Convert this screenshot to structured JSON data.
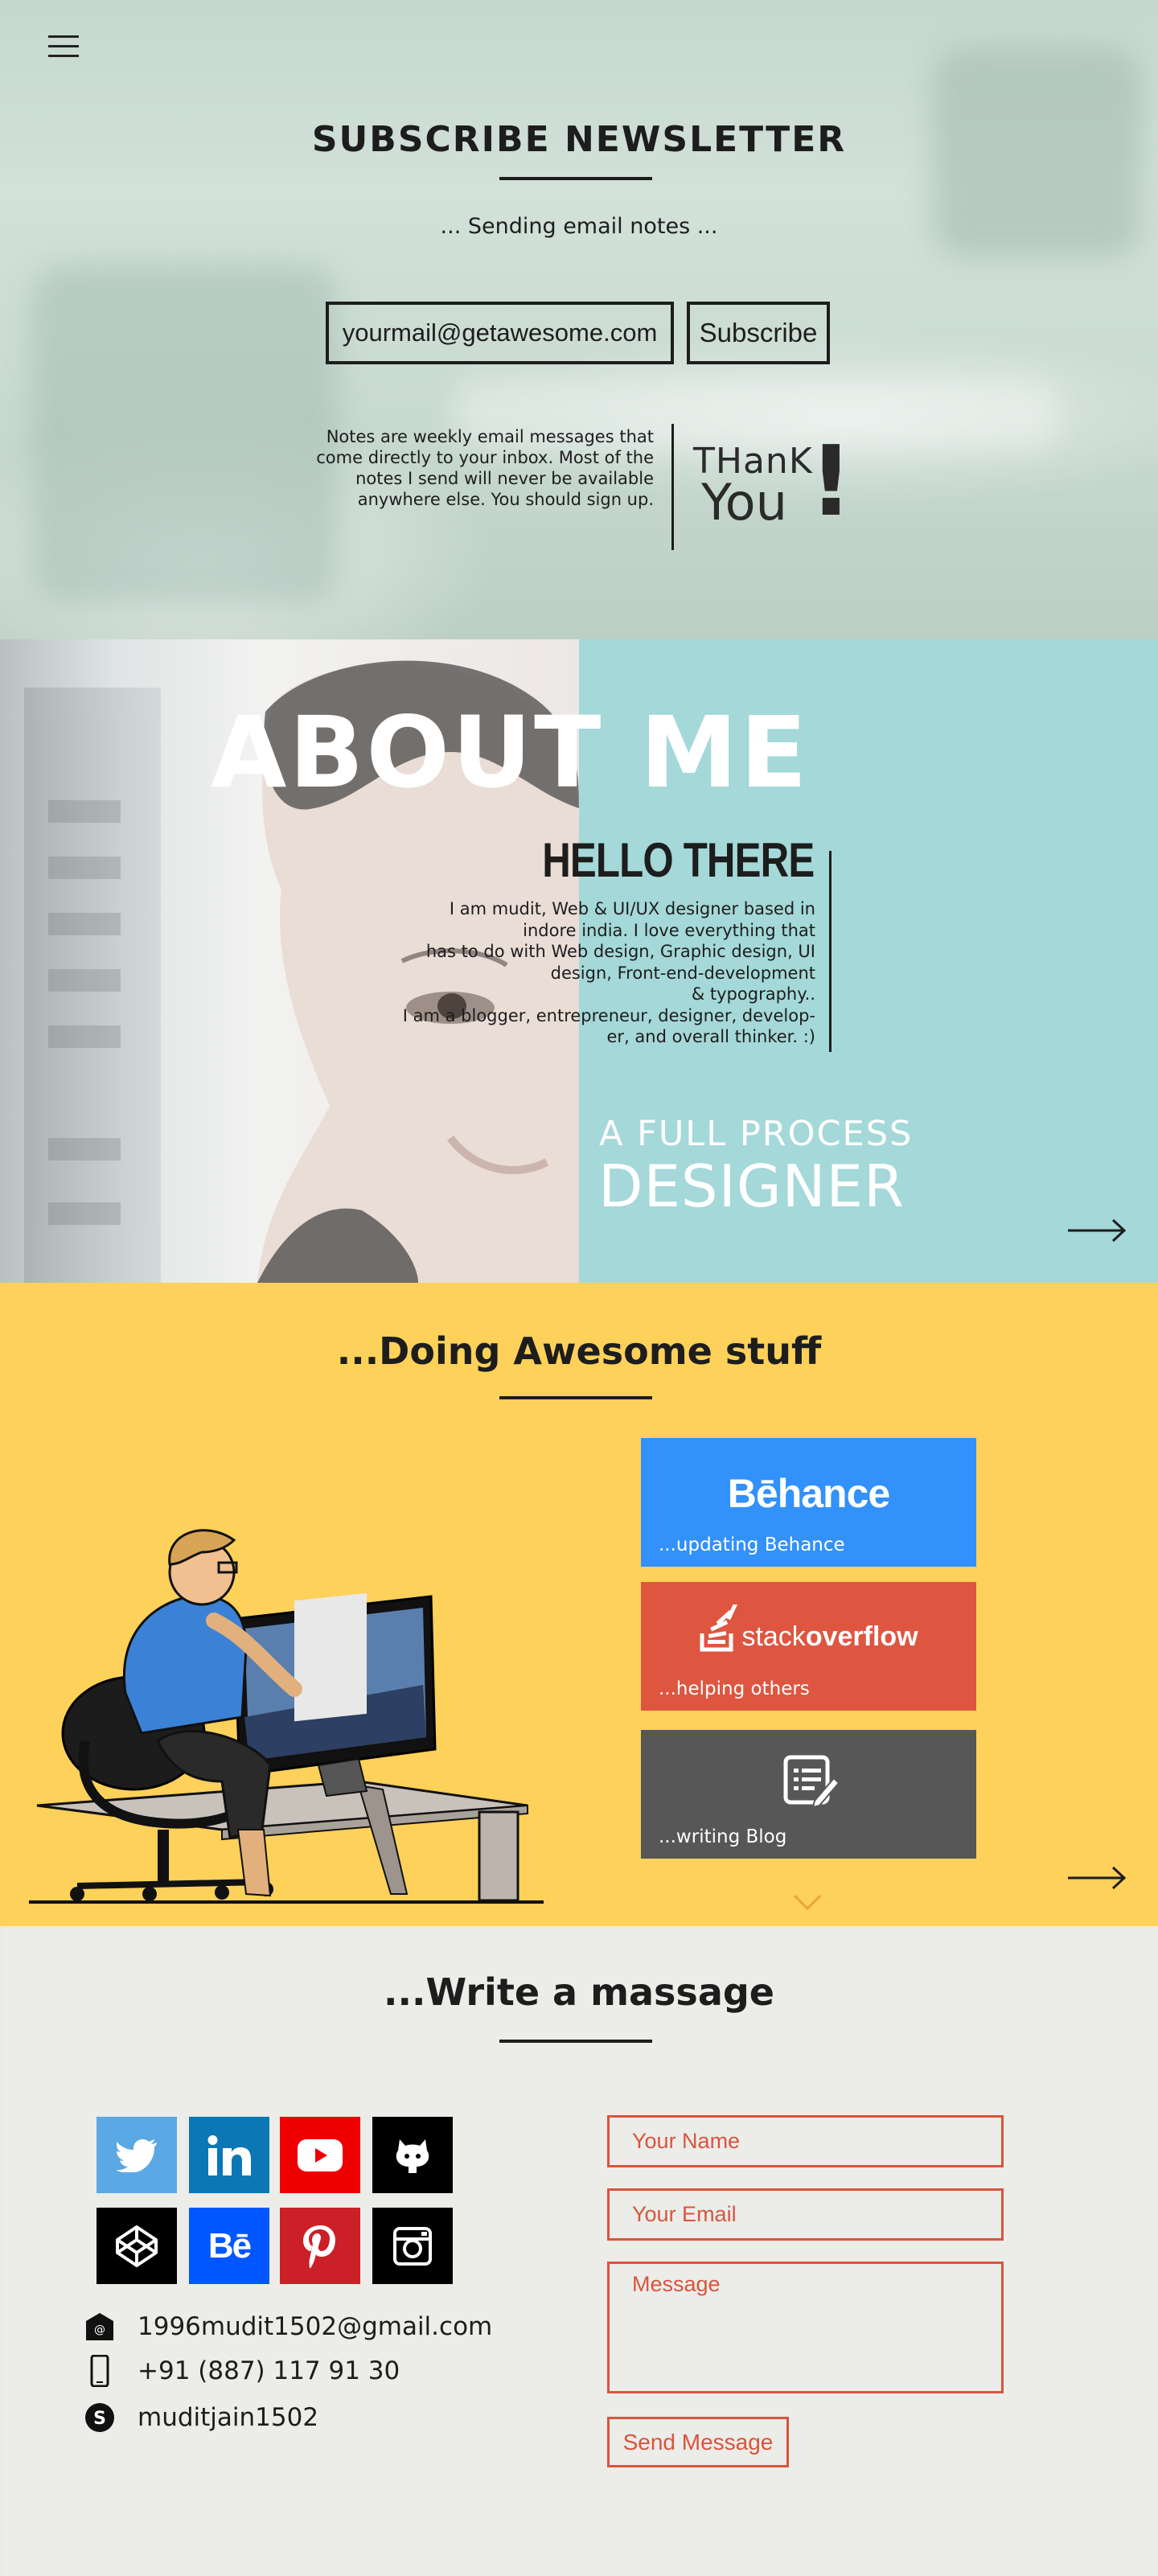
{
  "newsletter": {
    "title": "SUBSCRIBE NEWSLETTER",
    "subtitle": "... Sending email notes ...",
    "email_placeholder": "yourmail@getawesome.com",
    "subscribe_label": "Subscribe",
    "note": "Notes are weekly email messages that come directly to your inbox. Most of the notes I send will never be available anywhere else. You should sign up.",
    "thank": "THanK",
    "you": "You",
    "exclaim": "!"
  },
  "about": {
    "title": "ABOUT ME",
    "hello": "HELLO THERE",
    "text_lines": [
      "I am mudit, Web & UI/UX designer based in",
      "indore india. I love everything that",
      "has to do with Web design, Graphic design, UI",
      "design, Front-end-development",
      "& typography..",
      "I am a blogger, entrepreneur, designer, develop-",
      "er, and overall thinker. :)"
    ],
    "tagline_small": "A FULL PROCESS",
    "tagline_big": "DESIGNER"
  },
  "awesome": {
    "title": "...Doing Awesome stuff",
    "cards": [
      {
        "logo": "Bēhance",
        "caption": "...updating Behance",
        "color": "#3291fa"
      },
      {
        "logo_light": "stack",
        "logo_bold": "overflow",
        "caption": "...helping others",
        "color": "#de5640"
      },
      {
        "caption": "...writing Blog",
        "color": "#575757"
      }
    ]
  },
  "contact": {
    "title": "...Write a massage",
    "social": [
      {
        "name": "twitter-icon",
        "color": "#5ba9e4"
      },
      {
        "name": "linkedin-icon",
        "color": "#0b77b5"
      },
      {
        "name": "youtube-icon",
        "color": "#ee0000"
      },
      {
        "name": "github-icon",
        "color": "#000000"
      },
      {
        "name": "codepen-icon",
        "color": "#000000"
      },
      {
        "name": "behance-icon",
        "color": "#0057ff",
        "label": "Bē"
      },
      {
        "name": "pinterest-icon",
        "color": "#cb2027"
      },
      {
        "name": "instagram-icon",
        "color": "#000000"
      }
    ],
    "email": "1996mudit1502@gmail.com",
    "phone": "+91 (887) 117 91 30",
    "skype": "muditjain1502",
    "name_placeholder": "Your Name",
    "email_placeholder": "Your Email",
    "message_placeholder": "Message",
    "send_label": "Send Message"
  }
}
